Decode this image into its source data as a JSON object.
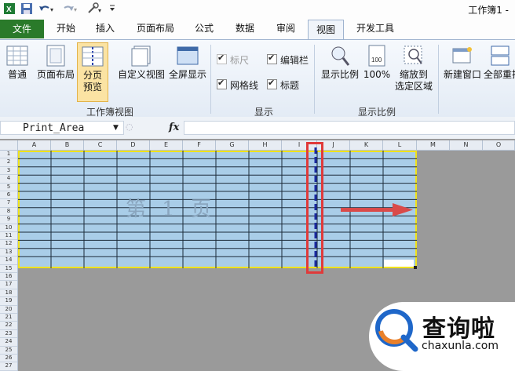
{
  "window": {
    "title": "工作簿1 -"
  },
  "quick_access": {
    "icons": [
      "excel-icon",
      "save-icon",
      "undo-icon",
      "redo-icon",
      "tools-icon",
      "customize-icon"
    ]
  },
  "tabs": [
    "文件",
    "开始",
    "插入",
    "页面布局",
    "公式",
    "数据",
    "审阅",
    "视图",
    "开发工具"
  ],
  "active_tab": "视图",
  "ribbon": {
    "workbook_views": {
      "label": "工作簿视图",
      "normal": "普通",
      "page_layout": "页面布局",
      "page_break_1": "分页",
      "page_break_2": "预览",
      "custom_views": "自定义视图",
      "full_screen": "全屏显示"
    },
    "show": {
      "label": "显示",
      "ruler": "标尺",
      "formula_bar": "编辑栏",
      "gridlines": "网格线",
      "headings": "标题"
    },
    "zoom": {
      "label": "显示比例",
      "zoom": "显示比例",
      "hundred": "100%",
      "zoom_to_selection_1": "缩放到",
      "zoom_to_selection_2": "选定区域"
    },
    "window": {
      "new_window": "新建窗口",
      "arrange_all": "全部重排"
    }
  },
  "formula_bar": {
    "name_box": "Print_Area",
    "fx": "fx",
    "content": ""
  },
  "sheet": {
    "columns": [
      "A",
      "B",
      "C",
      "D",
      "E",
      "F",
      "G",
      "H",
      "I",
      "J",
      "K",
      "L",
      "M",
      "N",
      "O"
    ],
    "rows": [
      "1",
      "2",
      "3",
      "4",
      "5",
      "6",
      "7",
      "8",
      "9",
      "10",
      "11",
      "12",
      "13",
      "14",
      "15",
      "16",
      "17",
      "18",
      "19",
      "20",
      "21",
      "22",
      "23",
      "24",
      "25",
      "26",
      "27"
    ],
    "page_watermark": "第 1 页"
  },
  "watermark": {
    "brand": "查询啦",
    "url": "chaxunla.com"
  },
  "colors": {
    "file_tab": "#2a7a2a",
    "print_area": "#a9cde8",
    "print_border": "#f0e21a",
    "highlight": "#e03a3a",
    "page_break": "#1a2aa0"
  }
}
